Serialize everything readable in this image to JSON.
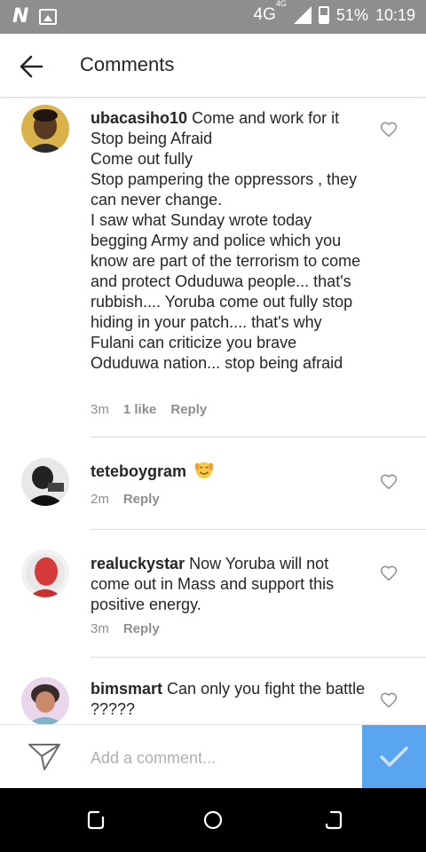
{
  "status_bar": {
    "network": "4G",
    "network_sup": "4G",
    "battery_percent": "51%",
    "time": "10:19"
  },
  "header": {
    "title": "Comments"
  },
  "comments": [
    {
      "username": "ubacasiho10",
      "text": "Come and work for it\nStop being Afraid\nCome out fully\nStop pampering the oppressors , they can never change.\nI saw what Sunday wrote today begging Army and police which you know are part of the terrorism to come and protect Oduduwa people... that's rubbish.... Yoruba come out fully stop hiding in your patch.... that's why Fulani can criticize you brave Oduduwa nation... stop being afraid",
      "time": "3m",
      "likes": "1 like",
      "reply_label": "Reply"
    },
    {
      "username": "teteboygram",
      "text": "",
      "emoji": "smiling-face-with-hands-icon",
      "time": "2m",
      "reply_label": "Reply"
    },
    {
      "username": "realuckystar",
      "text": "Now Yoruba will not come out in Mass and support this positive energy.",
      "time": "3m",
      "reply_label": "Reply"
    },
    {
      "username": "bimsmart",
      "text": "Can only you fight the battle ?????"
    }
  ],
  "composer": {
    "placeholder": "Add a comment..."
  },
  "colors": {
    "status_bar": "#8e8e8e",
    "post_button": "#5aa5f0",
    "meta_text": "#8e8e8e",
    "nav_bar": "#000000"
  }
}
